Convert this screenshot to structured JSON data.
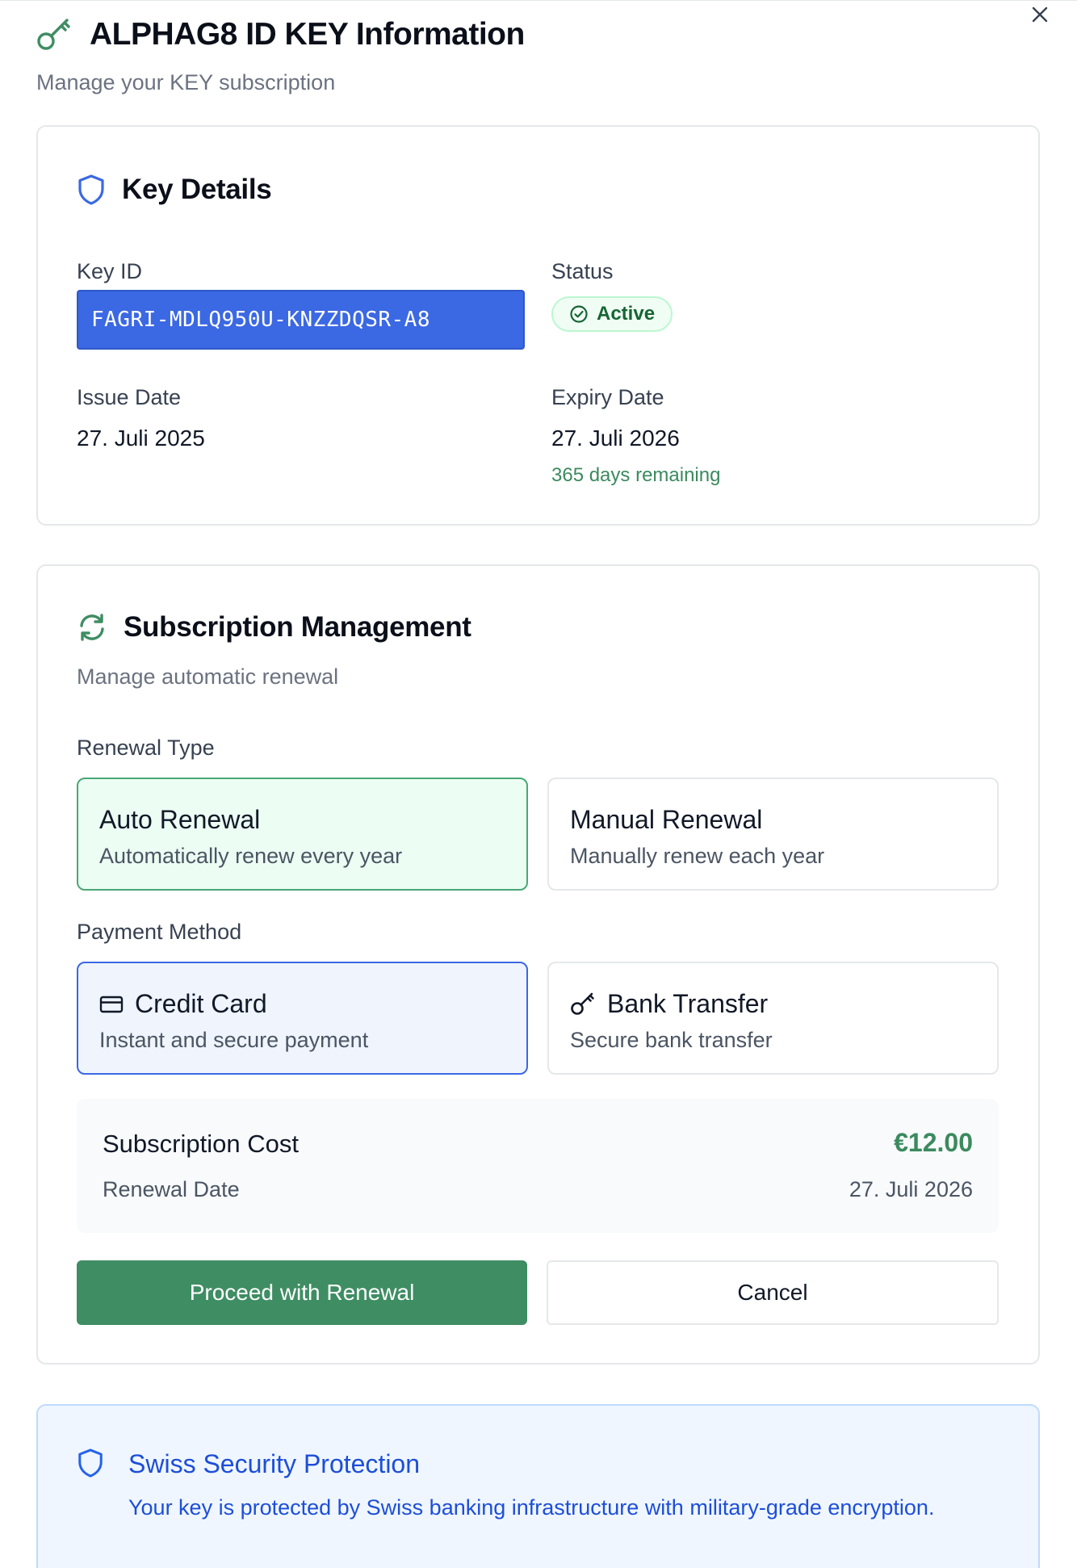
{
  "dialog": {
    "title": "ALPHAG8 ID KEY Information",
    "subtitle": "Manage your KEY subscription",
    "close_icon": "close-icon"
  },
  "key_details": {
    "title": "Key Details",
    "icon": "shield-icon",
    "key_id_label": "Key ID",
    "key_id_value": "FAGRI-MDLQ950U-KNZZDQSR-A8",
    "status_label": "Status",
    "status_value": "Active",
    "issue_date_label": "Issue Date",
    "issue_date_value": "27. Juli 2025",
    "expiry_date_label": "Expiry Date",
    "expiry_date_value": "27. Juli 2026",
    "days_remaining": "365 days remaining"
  },
  "subscription": {
    "title": "Subscription Management",
    "icon": "refresh-icon",
    "subtitle": "Manage automatic renewal",
    "renewal_type_label": "Renewal Type",
    "renewal_options": [
      {
        "title": "Auto Renewal",
        "description": "Automatically renew every year",
        "selected": true
      },
      {
        "title": "Manual Renewal",
        "description": "Manually renew each year",
        "selected": false
      }
    ],
    "payment_method_label": "Payment Method",
    "payment_options": [
      {
        "title": "Credit Card",
        "description": "Instant and secure payment",
        "icon": "credit-card-icon",
        "selected": true
      },
      {
        "title": "Bank Transfer",
        "description": "Secure bank transfer",
        "icon": "key-icon",
        "selected": false
      }
    ],
    "cost_label": "Subscription Cost",
    "cost_value": "€12.00",
    "renewal_date_label": "Renewal Date",
    "renewal_date_value": "27. Juli 2026",
    "proceed_button": "Proceed with Renewal",
    "cancel_button": "Cancel"
  },
  "security": {
    "title": "Swiss Security Protection",
    "icon": "shield-icon",
    "text": "Your key is protected by Swiss banking infrastructure with military-grade encryption."
  },
  "colors": {
    "accent_green": "#3f8d63",
    "accent_blue": "#3b68e3",
    "info_blue": "#1d4ed8"
  }
}
